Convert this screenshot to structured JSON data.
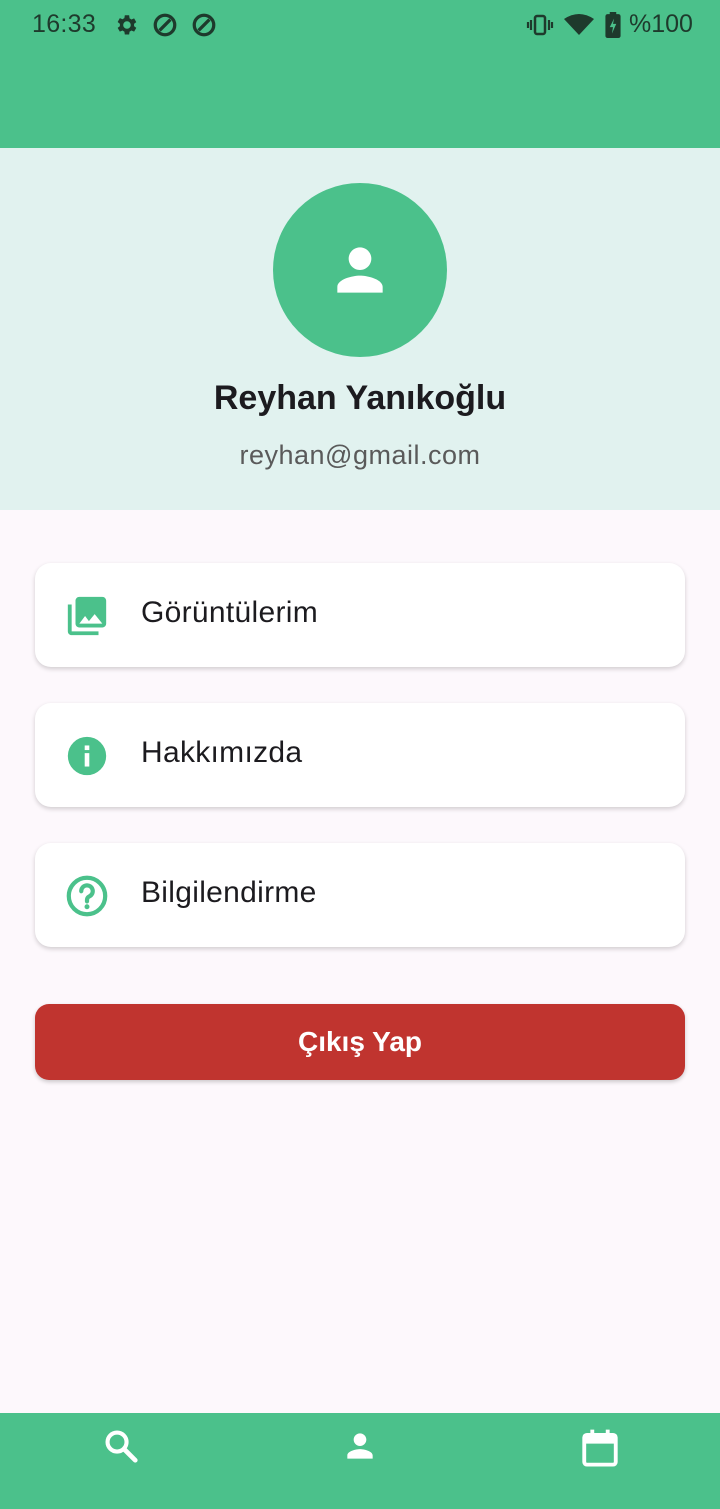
{
  "colors": {
    "primary": "#4BC18B",
    "header_bg": "#E1F2EF",
    "page_bg": "#FDF8FC",
    "danger": "#C0342F"
  },
  "status_bar": {
    "time": "16:33",
    "battery": "%100",
    "icons": [
      "settings-icon",
      "vpn-icon",
      "vpn-icon",
      "vibrate-icon",
      "wifi-icon",
      "battery-charging-icon"
    ]
  },
  "profile": {
    "avatar_icon": "person-icon",
    "name": "Reyhan Yanıkoğlu",
    "email": "reyhan@gmail.com"
  },
  "menu": {
    "items": [
      {
        "label": "Görüntülerim",
        "icon": "photo-library-icon"
      },
      {
        "label": "Hakkımızda",
        "icon": "info-icon"
      },
      {
        "label": "Bilgilendirme",
        "icon": "help-icon"
      }
    ]
  },
  "logout": {
    "label": "Çıkış Yap"
  },
  "bottom_nav": {
    "items": [
      {
        "icon": "search-icon"
      },
      {
        "icon": "person-icon"
      },
      {
        "icon": "calendar-icon"
      }
    ]
  }
}
